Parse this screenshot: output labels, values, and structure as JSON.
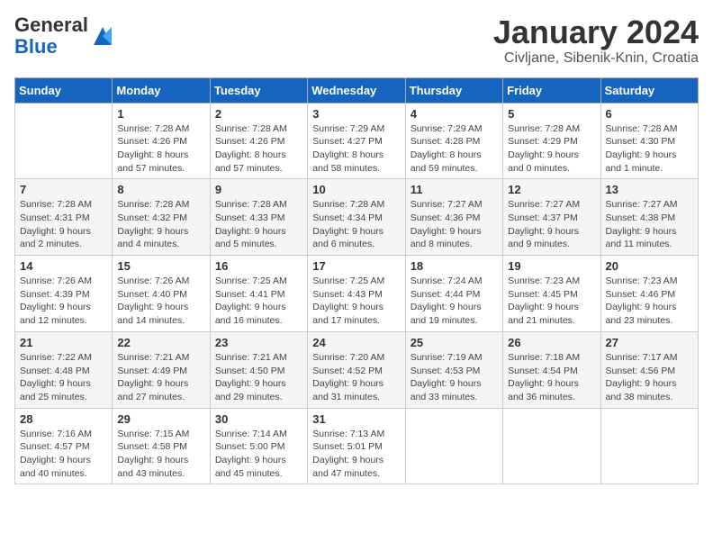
{
  "header": {
    "logo_general": "General",
    "logo_blue": "Blue",
    "title": "January 2024",
    "subtitle": "Civljane, Sibenik-Knin, Croatia"
  },
  "columns": [
    "Sunday",
    "Monday",
    "Tuesday",
    "Wednesday",
    "Thursday",
    "Friday",
    "Saturday"
  ],
  "weeks": [
    [
      {
        "day": "",
        "info": ""
      },
      {
        "day": "1",
        "info": "Sunrise: 7:28 AM\nSunset: 4:26 PM\nDaylight: 8 hours\nand 57 minutes."
      },
      {
        "day": "2",
        "info": "Sunrise: 7:28 AM\nSunset: 4:26 PM\nDaylight: 8 hours\nand 57 minutes."
      },
      {
        "day": "3",
        "info": "Sunrise: 7:29 AM\nSunset: 4:27 PM\nDaylight: 8 hours\nand 58 minutes."
      },
      {
        "day": "4",
        "info": "Sunrise: 7:29 AM\nSunset: 4:28 PM\nDaylight: 8 hours\nand 59 minutes."
      },
      {
        "day": "5",
        "info": "Sunrise: 7:28 AM\nSunset: 4:29 PM\nDaylight: 9 hours\nand 0 minutes."
      },
      {
        "day": "6",
        "info": "Sunrise: 7:28 AM\nSunset: 4:30 PM\nDaylight: 9 hours\nand 1 minute."
      }
    ],
    [
      {
        "day": "7",
        "info": "Sunrise: 7:28 AM\nSunset: 4:31 PM\nDaylight: 9 hours\nand 2 minutes."
      },
      {
        "day": "8",
        "info": "Sunrise: 7:28 AM\nSunset: 4:32 PM\nDaylight: 9 hours\nand 4 minutes."
      },
      {
        "day": "9",
        "info": "Sunrise: 7:28 AM\nSunset: 4:33 PM\nDaylight: 9 hours\nand 5 minutes."
      },
      {
        "day": "10",
        "info": "Sunrise: 7:28 AM\nSunset: 4:34 PM\nDaylight: 9 hours\nand 6 minutes."
      },
      {
        "day": "11",
        "info": "Sunrise: 7:27 AM\nSunset: 4:36 PM\nDaylight: 9 hours\nand 8 minutes."
      },
      {
        "day": "12",
        "info": "Sunrise: 7:27 AM\nSunset: 4:37 PM\nDaylight: 9 hours\nand 9 minutes."
      },
      {
        "day": "13",
        "info": "Sunrise: 7:27 AM\nSunset: 4:38 PM\nDaylight: 9 hours\nand 11 minutes."
      }
    ],
    [
      {
        "day": "14",
        "info": "Sunrise: 7:26 AM\nSunset: 4:39 PM\nDaylight: 9 hours\nand 12 minutes."
      },
      {
        "day": "15",
        "info": "Sunrise: 7:26 AM\nSunset: 4:40 PM\nDaylight: 9 hours\nand 14 minutes."
      },
      {
        "day": "16",
        "info": "Sunrise: 7:25 AM\nSunset: 4:41 PM\nDaylight: 9 hours\nand 16 minutes."
      },
      {
        "day": "17",
        "info": "Sunrise: 7:25 AM\nSunset: 4:43 PM\nDaylight: 9 hours\nand 17 minutes."
      },
      {
        "day": "18",
        "info": "Sunrise: 7:24 AM\nSunset: 4:44 PM\nDaylight: 9 hours\nand 19 minutes."
      },
      {
        "day": "19",
        "info": "Sunrise: 7:23 AM\nSunset: 4:45 PM\nDaylight: 9 hours\nand 21 minutes."
      },
      {
        "day": "20",
        "info": "Sunrise: 7:23 AM\nSunset: 4:46 PM\nDaylight: 9 hours\nand 23 minutes."
      }
    ],
    [
      {
        "day": "21",
        "info": "Sunrise: 7:22 AM\nSunset: 4:48 PM\nDaylight: 9 hours\nand 25 minutes."
      },
      {
        "day": "22",
        "info": "Sunrise: 7:21 AM\nSunset: 4:49 PM\nDaylight: 9 hours\nand 27 minutes."
      },
      {
        "day": "23",
        "info": "Sunrise: 7:21 AM\nSunset: 4:50 PM\nDaylight: 9 hours\nand 29 minutes."
      },
      {
        "day": "24",
        "info": "Sunrise: 7:20 AM\nSunset: 4:52 PM\nDaylight: 9 hours\nand 31 minutes."
      },
      {
        "day": "25",
        "info": "Sunrise: 7:19 AM\nSunset: 4:53 PM\nDaylight: 9 hours\nand 33 minutes."
      },
      {
        "day": "26",
        "info": "Sunrise: 7:18 AM\nSunset: 4:54 PM\nDaylight: 9 hours\nand 36 minutes."
      },
      {
        "day": "27",
        "info": "Sunrise: 7:17 AM\nSunset: 4:56 PM\nDaylight: 9 hours\nand 38 minutes."
      }
    ],
    [
      {
        "day": "28",
        "info": "Sunrise: 7:16 AM\nSunset: 4:57 PM\nDaylight: 9 hours\nand 40 minutes."
      },
      {
        "day": "29",
        "info": "Sunrise: 7:15 AM\nSunset: 4:58 PM\nDaylight: 9 hours\nand 43 minutes."
      },
      {
        "day": "30",
        "info": "Sunrise: 7:14 AM\nSunset: 5:00 PM\nDaylight: 9 hours\nand 45 minutes."
      },
      {
        "day": "31",
        "info": "Sunrise: 7:13 AM\nSunset: 5:01 PM\nDaylight: 9 hours\nand 47 minutes."
      },
      {
        "day": "",
        "info": ""
      },
      {
        "day": "",
        "info": ""
      },
      {
        "day": "",
        "info": ""
      }
    ]
  ]
}
